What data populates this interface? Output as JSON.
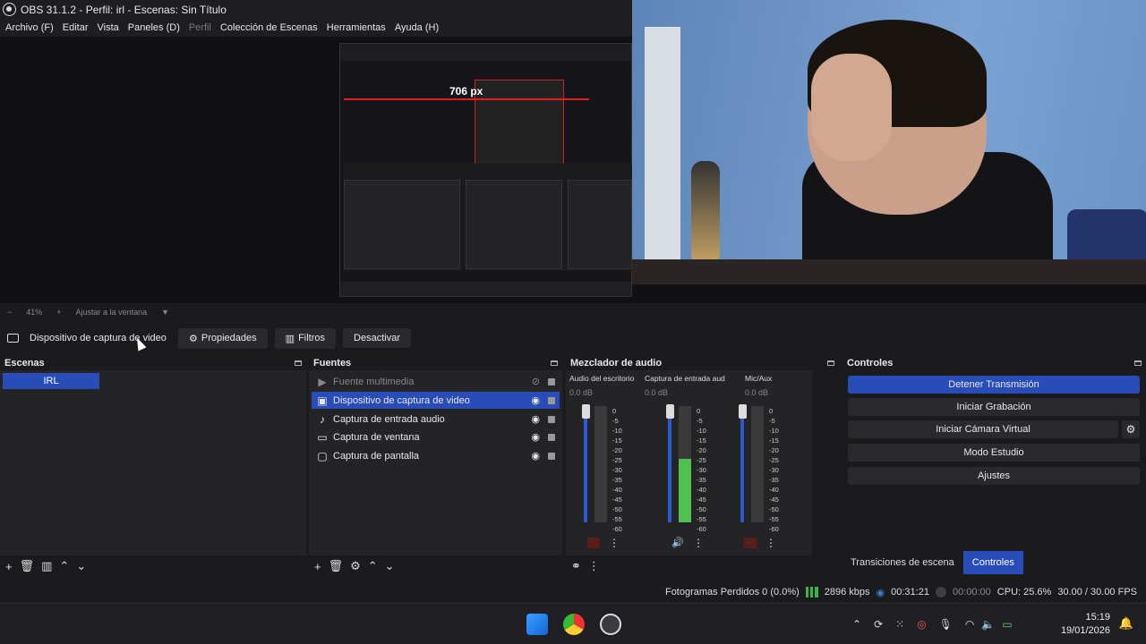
{
  "window": {
    "title": "OBS 31.1.2 - Perfil: irl - Escenas: Sin Título"
  },
  "menu": [
    "Archivo (F)",
    "Editar",
    "Vista",
    "Paneles (D)",
    "Perfil",
    "Colección de Escenas",
    "Herramientas",
    "Ayuda (H)"
  ],
  "preview": {
    "measure_label": "706 px"
  },
  "zoom": {
    "minus": "−",
    "value": "41%",
    "plus": "+",
    "fit": "Ajustar a la ventana"
  },
  "source_toolbar": {
    "source_name": "Dispositivo de captura de video",
    "properties": "Propiedades",
    "filters": "Filtros",
    "deactivate": "Desactivar"
  },
  "scenes": {
    "title": "Escenas",
    "items": [
      "IRL"
    ]
  },
  "sources": {
    "title": "Fuentes",
    "items": [
      {
        "label": "Fuente multimedia",
        "icon": "play-icon"
      },
      {
        "label": "Dispositivo de captura de video",
        "icon": "camera-icon"
      },
      {
        "label": "Captura de entrada audio",
        "icon": "microphone-icon"
      },
      {
        "label": "Captura de ventana",
        "icon": "window-icon"
      },
      {
        "label": "Captura de pantalla",
        "icon": "monitor-icon"
      }
    ]
  },
  "mixer": {
    "title": "Mezclador de audio",
    "channels": [
      {
        "name": "Audio del escritorio",
        "db": "0.0 dB",
        "level": 0.0
      },
      {
        "name": "Captura de entrada aud",
        "db": "0.0 dB",
        "level": 0.55
      },
      {
        "name": "Mic/Aux",
        "db": "0.0 dB",
        "level": 0.0
      }
    ],
    "scale": [
      "0",
      "-5",
      "-10",
      "-15",
      "-20",
      "-25",
      "-30",
      "-35",
      "-40",
      "-45",
      "-50",
      "-55",
      "-60"
    ]
  },
  "controls": {
    "title": "Controles",
    "stop_stream": "Detener Transmisión",
    "start_recording": "Iniciar Grabación",
    "start_virtual_cam": "Iniciar Cámara Virtual",
    "studio_mode": "Modo Estudio",
    "settings": "Ajustes"
  },
  "bottom_tabs": [
    "Transiciones de escena",
    "Controles"
  ],
  "status": {
    "dropped_frames": "Fotogramas Perdidos 0 (0.0%)",
    "bitrate": "2896 kbps",
    "stream_time": "00:31:21",
    "rec_time": "00:00:00",
    "cpu": "CPU: 25.6%",
    "fps": "30.00 / 30.00 FPS"
  },
  "taskbar": {
    "time": "15:19",
    "date": "19/01/2026"
  },
  "colors": {
    "accent": "#284cb8",
    "meter_green": "#4fbf4f",
    "rec_red": "#e02020"
  }
}
